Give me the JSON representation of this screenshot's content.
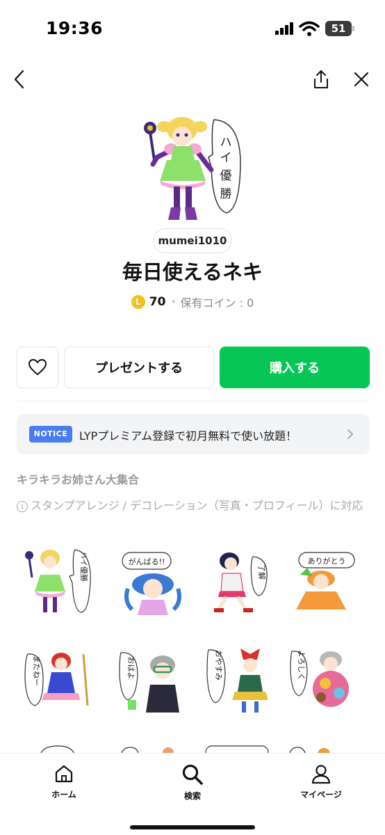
{
  "status_bar": {
    "time": "19:36",
    "battery": "51"
  },
  "header": {
    "back_icon": "chevron-left-icon",
    "share_icon": "share-icon",
    "close_icon": "close-icon"
  },
  "product": {
    "author": "mumei1010",
    "title": "毎日使えるネキ",
    "coin_symbol": "L",
    "price": "70",
    "coins_held": "保有コイン : 0"
  },
  "actions": {
    "favorite_icon": "heart-icon",
    "gift_label": "プレゼントする",
    "buy_label": "購入する",
    "buy_color": "#06c755"
  },
  "notice": {
    "badge": "NOTICE",
    "text": "LYPプレミアム登録で初月無料で使い放題！"
  },
  "series_label": "キラキラお姉さん大集合",
  "compat_text": "スタンプアレンジ / デコレーション（写真・プロフィール）に対応",
  "stickers": [
    {
      "caption": "ハイ優勝"
    },
    {
      "caption": "がんばる!!"
    },
    {
      "caption": "了解"
    },
    {
      "caption": "ありがとう"
    },
    {
      "caption": "またねー"
    },
    {
      "caption": "おはよ"
    },
    {
      "caption": "おやすみ"
    },
    {
      "caption": "よろしく"
    }
  ],
  "bottom_nav": [
    {
      "label": "ホーム",
      "icon": "home-icon"
    },
    {
      "label": "検索",
      "icon": "search-icon"
    },
    {
      "label": "マイページ",
      "icon": "user-icon"
    }
  ]
}
